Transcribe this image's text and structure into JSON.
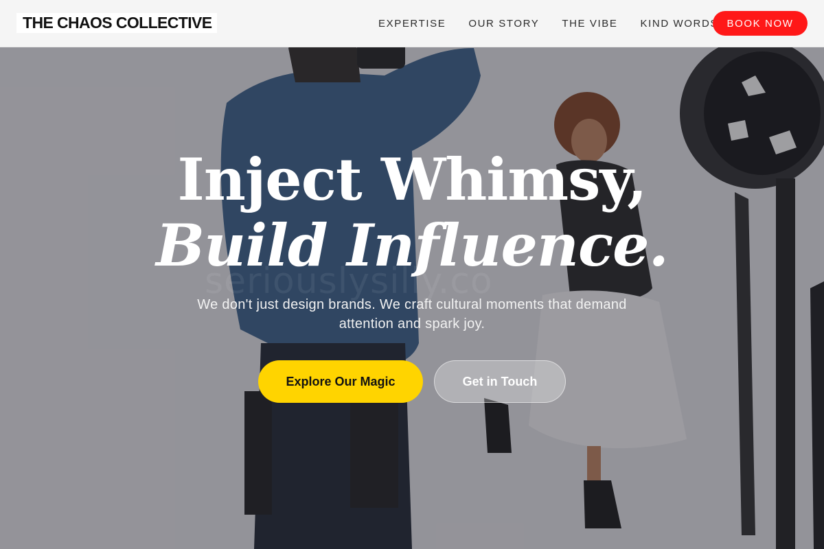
{
  "brand": {
    "name": "THE CHAOS COLLECTIVE"
  },
  "nav": {
    "items": [
      {
        "label": "EXPERTISE"
      },
      {
        "label": "OUR STORY"
      },
      {
        "label": "THE VIBE"
      },
      {
        "label": "KIND WORDS"
      }
    ],
    "cta_label": "BOOK NOW"
  },
  "hero": {
    "headline_line1": "Inject Whimsy,",
    "headline_line2": "Build Influence.",
    "watermark": "seriouslysilly.co",
    "subtext": "We don't just design brands. We craft cultural moments that demand attention and spark joy.",
    "primary_cta": "Explore Our Magic",
    "secondary_cta": "Get in Touch",
    "image_description": "photographer-and-model-studio-photo"
  },
  "colors": {
    "accent_red": "#ff1818",
    "accent_yellow": "#ffd400",
    "header_bg": "#f5f5f5"
  }
}
